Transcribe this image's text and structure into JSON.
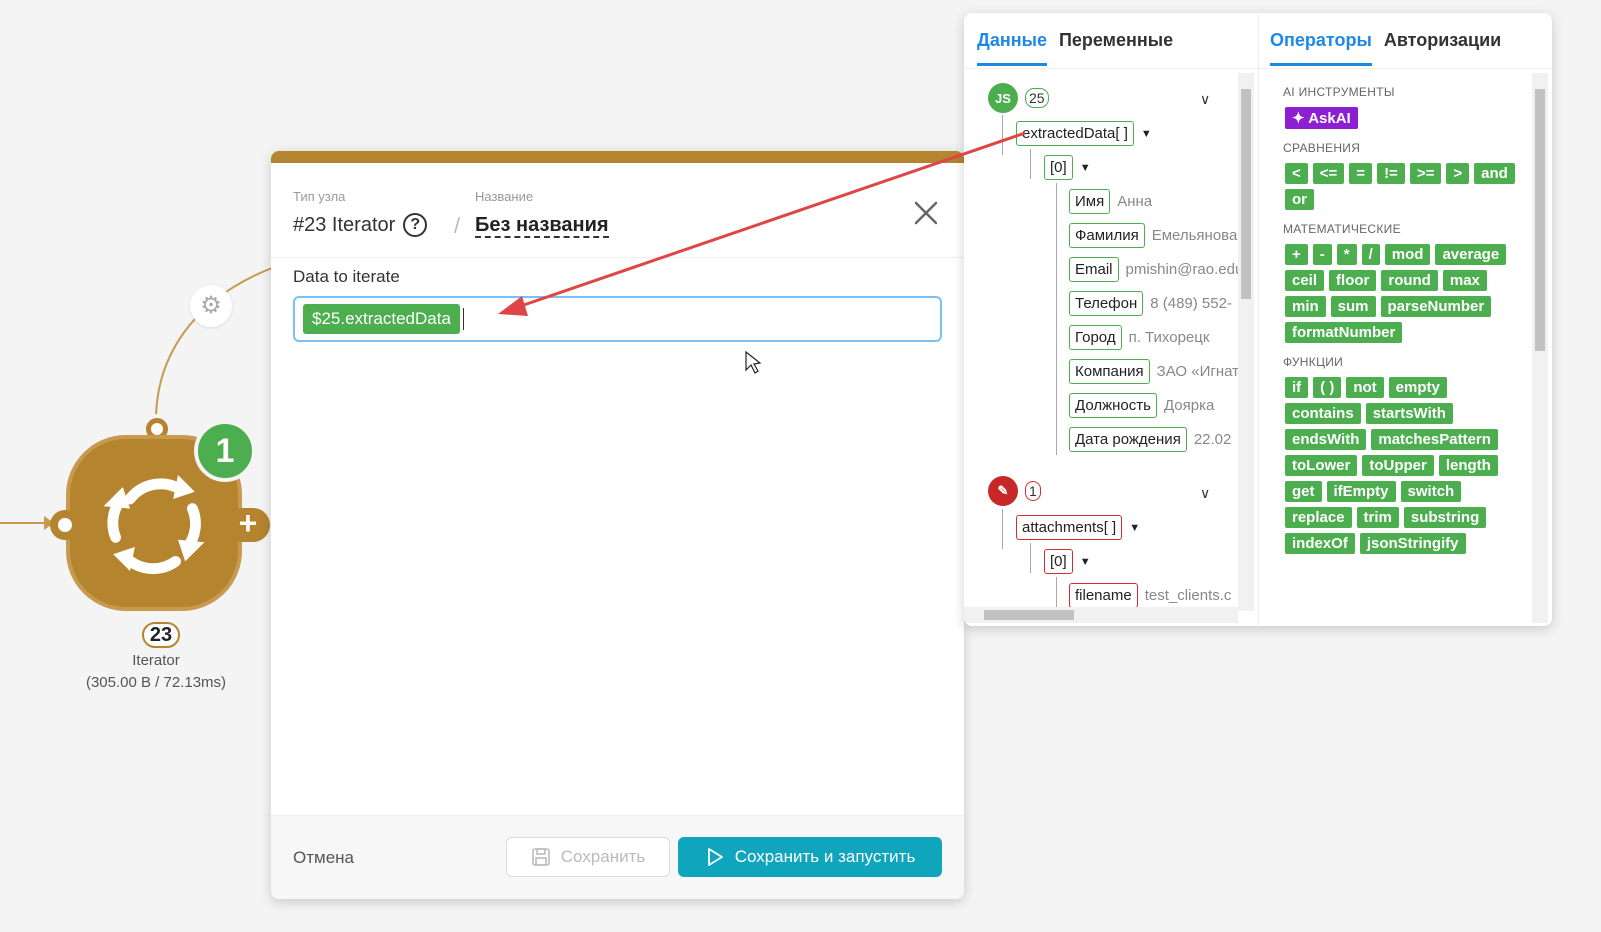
{
  "canvas": {
    "node": {
      "badge": "1",
      "id": "23",
      "type": "Iterator",
      "stats": "(305.00 B / 72.13ms)"
    }
  },
  "dialog": {
    "node_type_label": "Тип узла",
    "name_label": "Название",
    "node_title": "#23 Iterator",
    "node_name": "Без названия",
    "field_label": "Data to iterate",
    "field_value_chip": "$25.extractedData",
    "cancel_label": "Отмена",
    "save_label": "Сохранить",
    "run_label": "Сохранить и запустить"
  },
  "panel": {
    "left_tabs": [
      "Данные",
      "Переменные"
    ],
    "right_tabs": [
      "Операторы",
      "Авторизации"
    ],
    "tree": {
      "source1": {
        "icon_text": "JS",
        "count": "25",
        "key": "extractedData[ ]",
        "index": "[0]",
        "fields": [
          {
            "key": "Имя",
            "value": "Анна"
          },
          {
            "key": "Фамилия",
            "value": "Емельянова"
          },
          {
            "key": "Email",
            "value": "pmishin@rao.edu"
          },
          {
            "key": "Телефон",
            "value": "8 (489) 552-"
          },
          {
            "key": "Город",
            "value": "п. Тихорецк"
          },
          {
            "key": "Компания",
            "value": "ЗАО «Игнат"
          },
          {
            "key": "Должность",
            "value": "Доярка"
          },
          {
            "key": "Дата рождения",
            "value": "22.02"
          }
        ]
      },
      "source2": {
        "count": "1",
        "key": "attachments[ ]",
        "index": "[0]",
        "fields": [
          {
            "key": "filename",
            "value": "test_clients.c"
          }
        ]
      }
    },
    "sections": {
      "ai": {
        "title": "AI ИНСТРУМЕНТЫ",
        "items": [
          "AskAI"
        ]
      },
      "compare": {
        "title": "СРАВНЕНИЯ",
        "items": [
          "<",
          "<=",
          "=",
          "!=",
          ">=",
          ">",
          "and",
          "or"
        ]
      },
      "math": {
        "title": "МАТЕМАТИЧЕСКИЕ",
        "items": [
          "+",
          "-",
          "*",
          "/",
          "mod",
          "average",
          "ceil",
          "floor",
          "round",
          "max",
          "min",
          "sum",
          "parseNumber",
          "formatNumber"
        ]
      },
      "funcs": {
        "title": "ФУНКЦИИ",
        "items": [
          "if",
          "( )",
          "not",
          "empty",
          "contains",
          "startsWith",
          "endsWith",
          "matchesPattern",
          "toLower",
          "toUpper",
          "length",
          "get",
          "ifEmpty",
          "switch",
          "replace",
          "trim",
          "substring",
          "indexOf",
          "jsonStringify"
        ]
      }
    }
  },
  "colors": {
    "accent": "#1e88e5",
    "node": "#b5842e",
    "green": "#4cae4f",
    "run": "#0ea5bd",
    "ai": "#8b1fd1",
    "arrow": "#e04545"
  }
}
